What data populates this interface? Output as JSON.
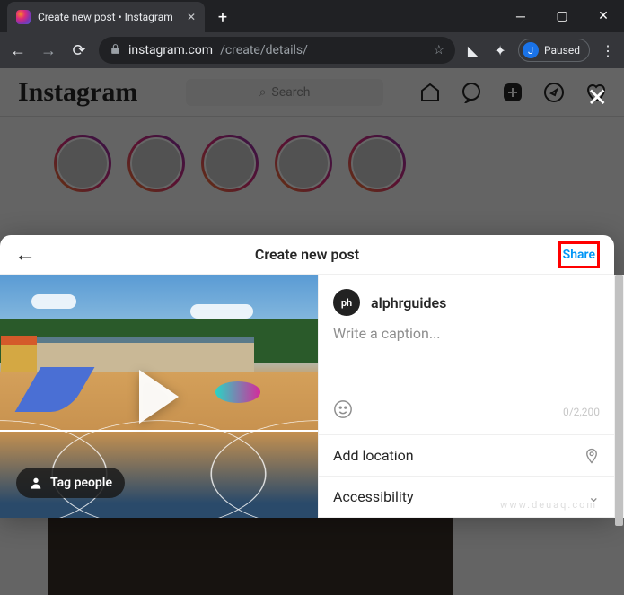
{
  "window": {
    "tab_title": "Create new post • Instagram",
    "url_domain": "instagram.com",
    "url_path": "/create/details/",
    "profile_label": "Paused",
    "profile_initial": "J"
  },
  "page": {
    "logo": "Instagram",
    "search_placeholder": "Search"
  },
  "modal": {
    "title": "Create new post",
    "share": "Share",
    "tag_people": "Tag people",
    "username": "alphrguides",
    "avatar_text": "ph",
    "caption_placeholder": "Write a caption...",
    "char_counter": "0/2,200",
    "add_location": "Add location",
    "accessibility": "Accessibility"
  },
  "watermark": "www.deuaq.com"
}
